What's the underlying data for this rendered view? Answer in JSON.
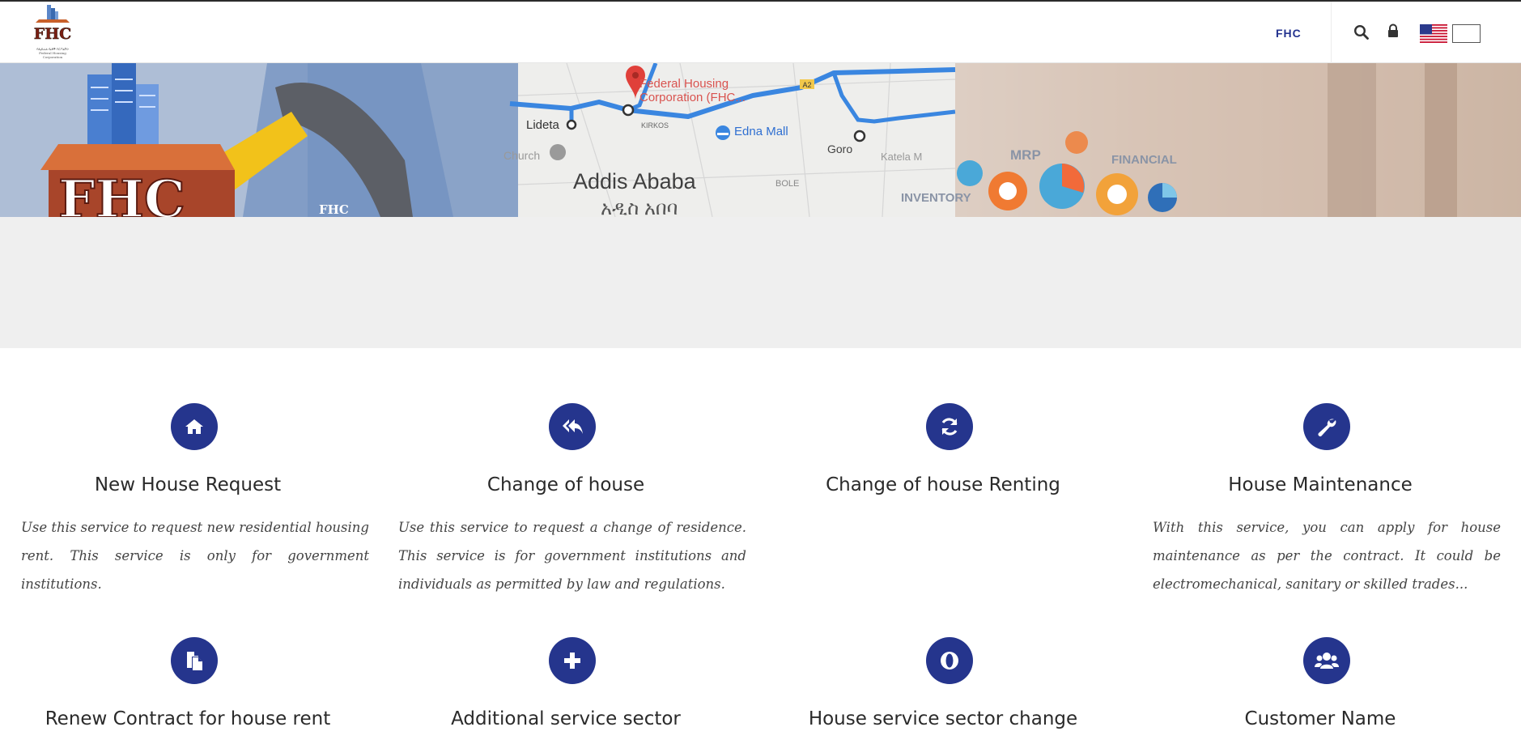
{
  "header": {
    "logo_text": "FHC",
    "logo_caption_amharic": "የፌዴራል ቤቶች ኮርፖሬሽን",
    "logo_caption_english": "Federal Housing Corporation",
    "nav_label": "FHC",
    "search_icon": "search-icon",
    "lock_icon": "lock-icon",
    "language_flags": [
      "us-flag",
      "blank-flag"
    ]
  },
  "banner": {
    "city": "Addis Ababa",
    "city_amharic": "አዲስ አበባ",
    "marker_label": "Federal Housing Corporation (FHC...",
    "lideta": "Lideta",
    "edna_mall": "Edna Mall",
    "goro": "Goro",
    "kirkos": "KIRKOS",
    "church": "Church",
    "katela": "Katela M",
    "bole": "BOLE",
    "road_badge": "A2",
    "mrp": "MRP",
    "financial": "FINANCIAL",
    "inventory": "INVENTORY",
    "fhc_watermark": "FHC",
    "colors": {
      "map_route": "#3a86e0",
      "marker": "#e0403a"
    }
  },
  "services": [
    {
      "title": "New House Request",
      "icon": "home-icon",
      "description": "Use this service to request new residential housing rent. This service is only for government institutions."
    },
    {
      "title": "Change of house",
      "icon": "reply-all-icon",
      "description": "Use this service to request a change of residence. This service is for government institutions and individuals as permitted by law and regulations."
    },
    {
      "title": "Change of house Renting",
      "icon": "refresh-icon",
      "description": ""
    },
    {
      "title": "House Maintenance",
      "icon": "wrench-icon",
      "description": "With this service, you can apply for house maintenance as per the contract. It could be electromechanical, sanitary or skilled trades..."
    },
    {
      "title": "Renew Contract for house rent",
      "icon": "files-icon",
      "description": ""
    },
    {
      "title": "Additional service sector",
      "icon": "plus-icon",
      "description": ""
    },
    {
      "title": "House service sector change",
      "icon": "opera-icon",
      "description": ""
    },
    {
      "title": "Customer Name",
      "icon": "users-icon",
      "description": ""
    }
  ],
  "colors": {
    "brand_blue": "#25358d",
    "nav_text": "#24338f"
  }
}
